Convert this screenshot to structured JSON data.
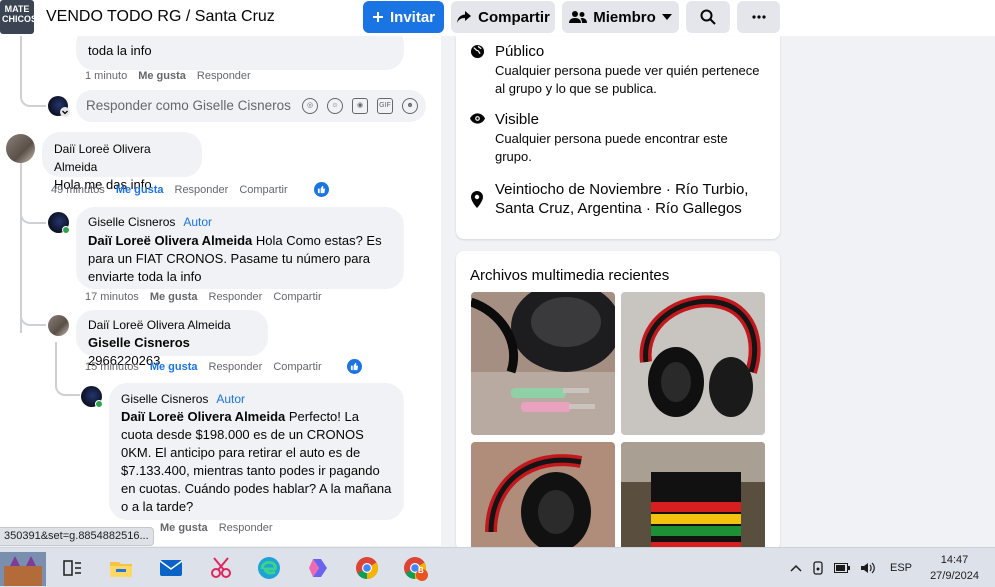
{
  "header": {
    "group_logo_text": "MATE CHICOS",
    "group_title": "VENDO TODO RG / Santa Cruz",
    "invite_label": "Invitar",
    "share_label": "Compartir",
    "member_label": "Miembro"
  },
  "comments": {
    "c0": {
      "text_tail": "toda la info",
      "time": "1 minuto",
      "like": "Me gusta",
      "reply": "Responder"
    },
    "reply_box": {
      "placeholder": "Responder como Giselle Cisneros"
    },
    "c1": {
      "author": "Daiï Loreë Olivera Almeida",
      "text": "Hola me das info",
      "time": "49 minutos",
      "like": "Me gusta",
      "reply": "Responder",
      "share": "Compartir"
    },
    "c2": {
      "author": "Giselle Cisneros",
      "badge": "Autor",
      "mention": "Daiï Loreë Olivera Almeida",
      "text": " Hola Como estas? Es para un FIAT CRONOS. Pasame tu número para enviarte toda la info",
      "time": "17 minutos",
      "like": "Me gusta",
      "reply": "Responder",
      "share": "Compartir"
    },
    "c3": {
      "author": "Daiï Loreë Olivera Almeida",
      "mention": "Giselle Cisneros",
      "text": " 2966220263",
      "time": "15 minutos",
      "like": "Me gusta",
      "reply": "Responder",
      "share": "Compartir"
    },
    "c4": {
      "author": "Giselle Cisneros",
      "badge": "Autor",
      "mention": "Daiï Loreë Olivera Almeida",
      "text": " Perfecto! La cuota desde $198.000 es de un CRONOS 0KM. El anticipo para retirar el auto es de $7.133.400, mientras tanto podes ir pagando en cuotas. Cuándo podes hablar? A la mañana o a la tarde?",
      "like": "Me gusta",
      "reply": "Responder"
    }
  },
  "about": {
    "public_title": "Público",
    "public_desc": "Cualquier persona puede ver quién pertenece al grupo y lo que se publica.",
    "visible_title": "Visible",
    "visible_desc": "Cualquier persona puede encontrar este grupo.",
    "location": "Veintiocho de Noviembre · Río Turbio, Santa Cruz, Argentina · Río Gallegos"
  },
  "media": {
    "title": "Archivos multimedia recientes"
  },
  "url_preview": "350391&set=g.8854882516...",
  "taskbar": {
    "lang": "ESP",
    "time": "14:47",
    "date": "27/9/2024",
    "chrome_badge": "B"
  },
  "colors": {
    "accent": "#1b74e4",
    "online": "#31a24c",
    "bubble": "#f0f2f5"
  }
}
